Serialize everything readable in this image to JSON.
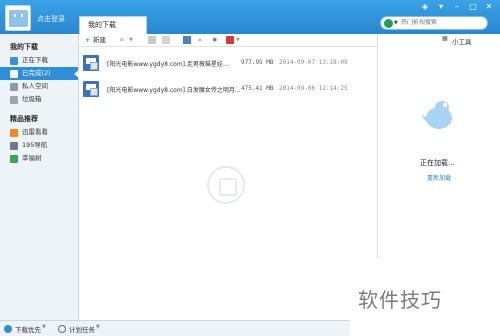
{
  "titlebar": {
    "login_text": "点击登录",
    "tab_label": "我的下载",
    "search_placeholder": "热门影视搜索"
  },
  "sidebar": {
    "section_downloads": "我的下载",
    "items": [
      {
        "label": "正在下载"
      },
      {
        "label": "已完成(2)"
      },
      {
        "label": "私人空间"
      },
      {
        "label": "垃圾箱"
      }
    ],
    "section_recommend": "精品推荐",
    "rec_items": [
      {
        "label": "迅雷看看"
      },
      {
        "label": "195导航"
      },
      {
        "label": "幸福树"
      }
    ]
  },
  "toolbar": {
    "new_label": "新建",
    "tools_label": "小工具"
  },
  "files": [
    {
      "name": "[阳光电影www.ygdy8.com].走男薇猫星娃...",
      "size": "977.95 MB",
      "date": "2014-09-07 13:18:09"
    },
    {
      "name": "[阳光电影www.ygdy8.com].白发魔女传之明月...",
      "size": "475.41 MB",
      "date": "2014-09-06 12:14:25"
    }
  ],
  "right_pane": {
    "loading_text": "正在加载...",
    "reload_text": "重新加载"
  },
  "statusbar": {
    "download_priority": "下载优先",
    "scheduled_tasks": "计划任务"
  },
  "watermark_brand": "软件技巧",
  "colors": {
    "titlebar": "#2a86cf",
    "active_item": "#2d8fd8",
    "link": "#2f7fd3"
  }
}
